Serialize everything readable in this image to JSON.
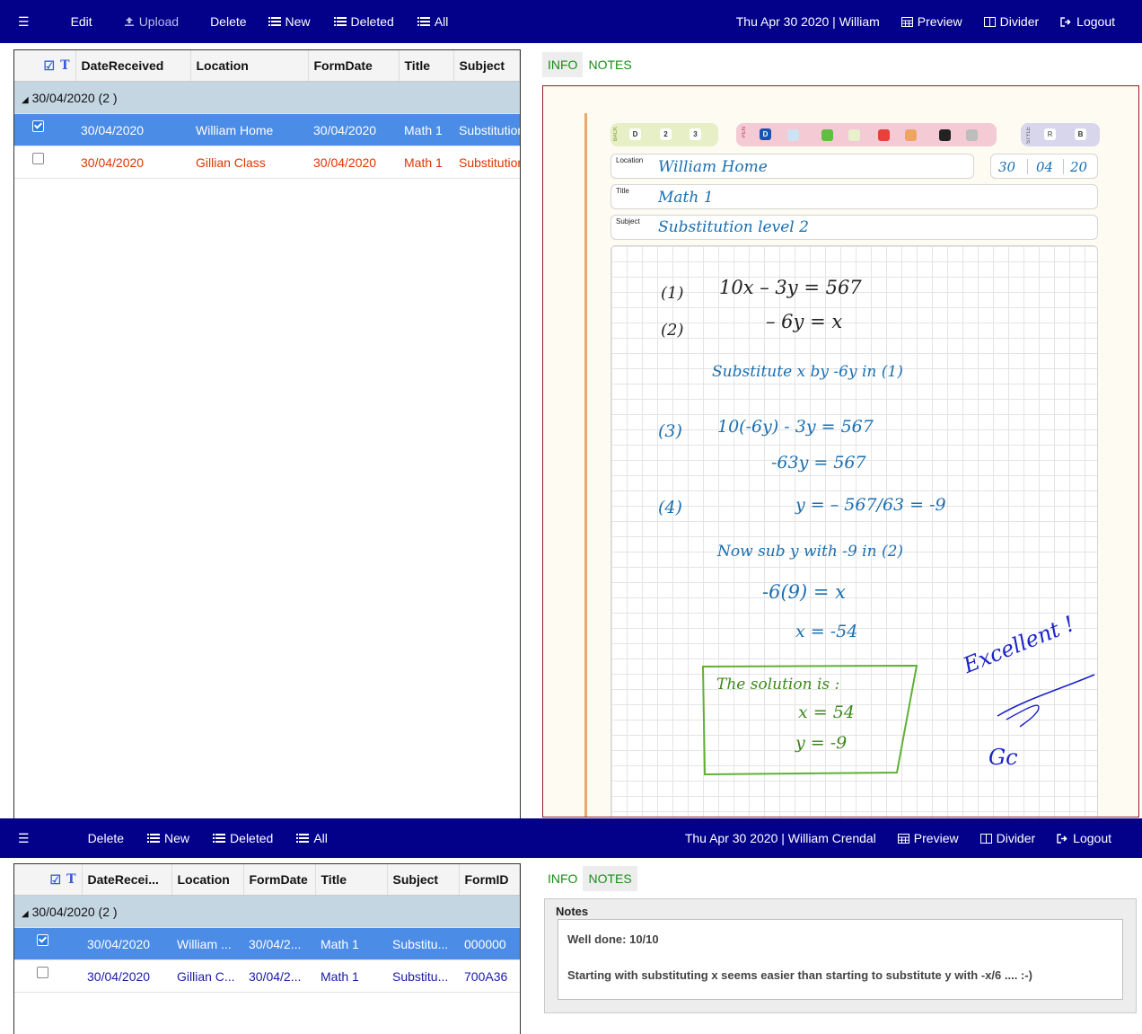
{
  "top": {
    "menu_icon": "menu-icon",
    "edit": "Edit",
    "upload": "Upload",
    "delete": "Delete",
    "new": "New",
    "deleted": "Deleted",
    "all": "All",
    "status": "Thu Apr 30 2020 | William",
    "preview": "Preview",
    "divider": "Divider",
    "logout": "Logout"
  },
  "top_grid": {
    "columns": [
      "DateReceived",
      "Location",
      "FormDate",
      "Title",
      "Subject"
    ],
    "group": "30/04/2020 (2 )",
    "rows": [
      [
        "30/04/2020",
        "William Home",
        "30/04/2020",
        "Math 1",
        "Substitution"
      ],
      [
        "30/04/2020",
        "Gillian Class",
        "30/04/2020",
        "Math 1",
        "Substitution"
      ]
    ]
  },
  "tabs": {
    "info": "INFO",
    "notes": "NOTES"
  },
  "form": {
    "back_label": "BACK",
    "pen_label": "PEN",
    "style_label": "STYLE",
    "back_options": [
      "D",
      "2",
      "3"
    ],
    "pen_active": "D",
    "style_options": [
      "R",
      "B"
    ],
    "pen_colors": [
      "#cde3f4",
      "#5fbf3e",
      "#e7f2cc",
      "#e8403a",
      "#efa55f",
      "#222222",
      "#bdbdbd"
    ],
    "location_label": "Location",
    "location_value": "William Home",
    "date_day": "30",
    "date_month": "04",
    "date_year": "20",
    "title_label": "Title",
    "title_value": "Math 1",
    "subject_label": "Subject",
    "subject_value": "Substitution level 2"
  },
  "handwriting": {
    "l1_num": "(1)",
    "l1_eq": "10x  –  3y   =   567",
    "l2_num": "(2)",
    "l2_eq": "– 6y   =   x",
    "note1": "Substitute x by -6y in (1)",
    "l3_num": "(3)",
    "l3_eq": "10(-6y) - 3y   =   567",
    "l3b": "-63y   =   567",
    "l4_num": "(4)",
    "l4_eq": "y   =  – 567/63  =  -9",
    "note2": "Now sub y with -9 in (2)",
    "l5": "-6(9)  =  x",
    "l6": "x   =  -54",
    "box_title": "The solution is :",
    "box_x": "x  =  54",
    "box_y": "y  =  -9",
    "comment": "Excellent !",
    "initials": "Gc"
  },
  "bottom": {
    "delete": "Delete",
    "new": "New",
    "deleted": "Deleted",
    "all": "All",
    "status": "Thu Apr 30 2020 | William Crendal",
    "preview": "Preview",
    "divider": "Divider",
    "logout": "Logout"
  },
  "bottom_grid": {
    "columns": [
      "DateRecei...",
      "Location",
      "FormDate",
      "Title",
      "Subject",
      "FormID"
    ],
    "group": "30/04/2020 (2 )",
    "rows": [
      [
        "30/04/2020",
        "William ...",
        "30/04/2...",
        "Math 1",
        "Substitu...",
        "000000"
      ],
      [
        "30/04/2020",
        "Gillian C...",
        "30/04/2...",
        "Math 1",
        "Substitu...",
        "700A36"
      ]
    ]
  },
  "notes": {
    "title": "Notes",
    "line1": "Well done: 10/10",
    "line2": "Starting with substituting x seems easier than starting to substitute y with -x/6 .... :-)"
  }
}
